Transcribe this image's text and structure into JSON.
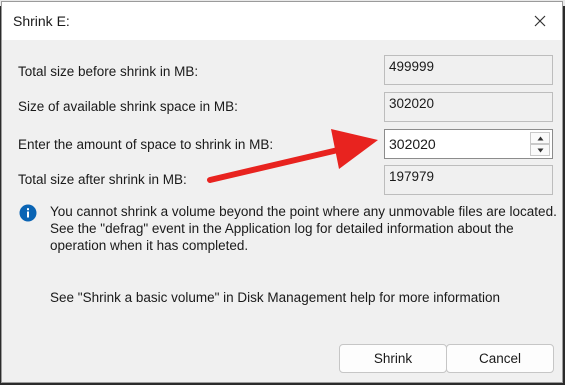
{
  "dialog": {
    "title": "Shrink E:",
    "close_icon": "close-icon"
  },
  "fields": {
    "total_before": {
      "label": "Total size before shrink in MB:",
      "value": "499999"
    },
    "available": {
      "label": "Size of available shrink space in MB:",
      "value": "302020"
    },
    "shrink_amount": {
      "label": "Enter the amount of space to shrink in MB:",
      "value": "302020"
    },
    "total_after": {
      "label": "Total size after shrink in MB:",
      "value": "197979"
    }
  },
  "info": {
    "icon": "info-icon",
    "lines": [
      "You cannot shrink a volume beyond the point where any unmovable files are located.",
      "See the \"defrag\" event in the Application log for detailed information about the",
      "operation when it has completed."
    ]
  },
  "help_text": "See \"Shrink a basic volume\" in Disk Management help for more information",
  "buttons": {
    "shrink": "Shrink",
    "cancel": "Cancel"
  },
  "colors": {
    "annotation_arrow": "#e8231f",
    "info_icon": "#0a64b4"
  }
}
